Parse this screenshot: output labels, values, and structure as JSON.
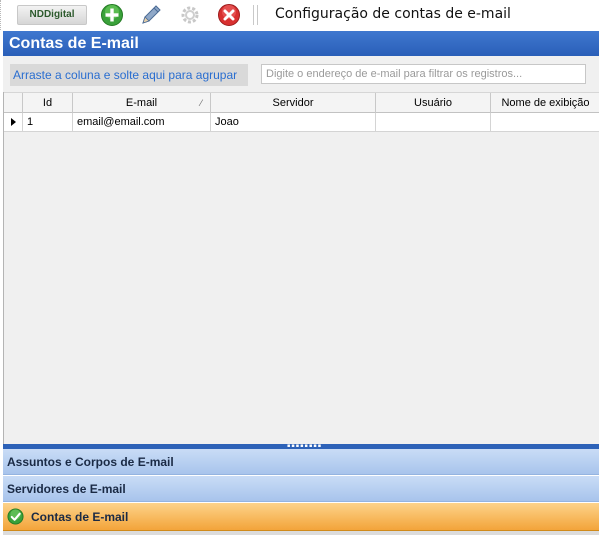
{
  "toolbar": {
    "logo": "NDDigital",
    "title": "Configuração de contas de e-mail",
    "buttons": [
      {
        "name": "add",
        "icon": "plus-circle-icon",
        "color": "#3aa13a"
      },
      {
        "name": "edit",
        "icon": "pencil-icon",
        "color": "#5a7fb0"
      },
      {
        "name": "settings",
        "icon": "gear-icon",
        "color": "#c8c8c8"
      },
      {
        "name": "delete",
        "icon": "close-circle-icon",
        "color": "#d83030"
      }
    ]
  },
  "panel": {
    "title": "Contas de E-mail"
  },
  "groupbar": {
    "group_hint": "Arraste a coluna e solte aqui para agrupar",
    "filter_placeholder": "Digite o endereço de e-mail para filtrar os registros..."
  },
  "grid": {
    "columns": [
      "Id",
      "E-mail",
      "Servidor",
      "Usuário",
      "Nome de exibição"
    ],
    "rows": [
      {
        "id": "1",
        "email": "email@email.com",
        "servidor": "Joao",
        "usuario": "",
        "nome_exibicao": ""
      }
    ]
  },
  "navigation": {
    "items": [
      {
        "label": "Assuntos e Corpos de E-mail",
        "active": false
      },
      {
        "label": "Servidores de E-mail",
        "active": false
      },
      {
        "label": "Contas de E-mail",
        "active": true
      }
    ]
  },
  "colors": {
    "header_blue": "#2a5fb8",
    "nav_blue": "#a8c4ec",
    "nav_active": "#f3a43a",
    "link_blue": "#2a6ed0"
  }
}
